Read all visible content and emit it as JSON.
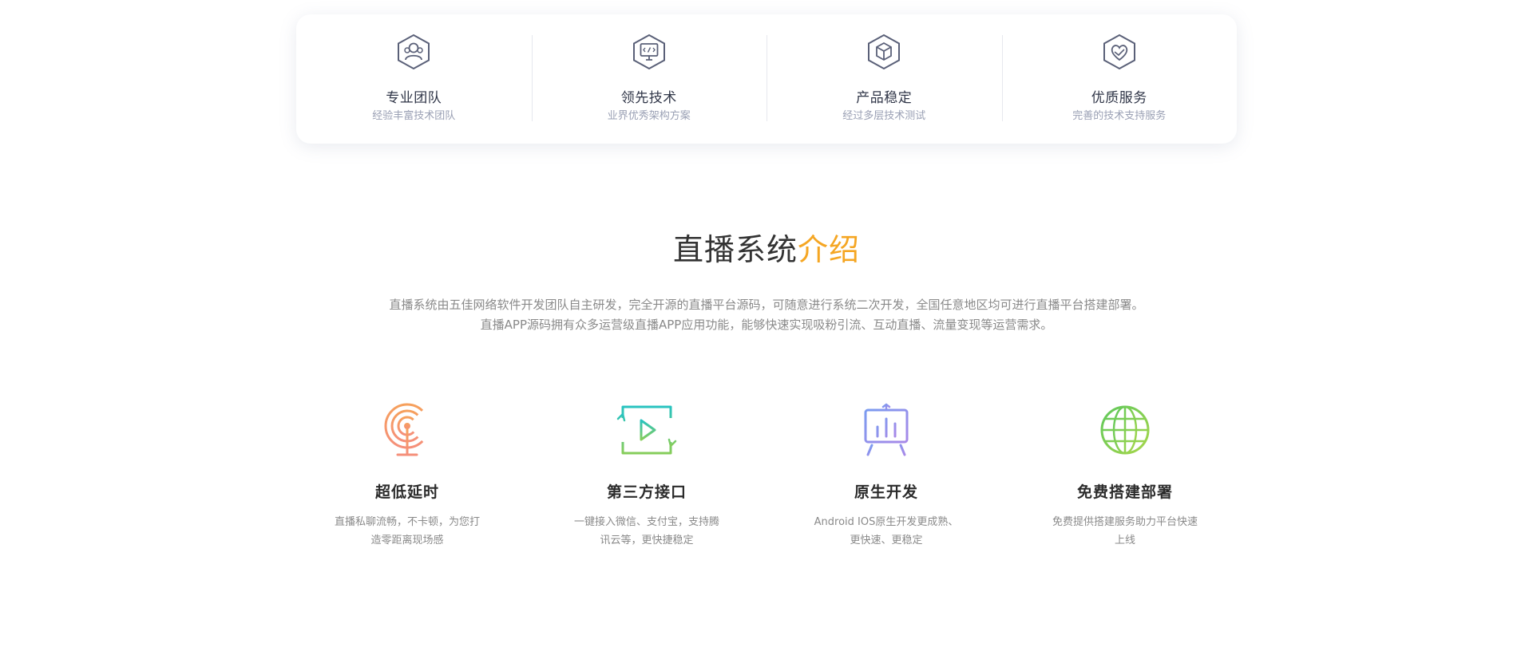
{
  "features": [
    {
      "icon": "team-icon",
      "title": "专业团队",
      "subtitle": "经验丰富技术团队"
    },
    {
      "icon": "code-monitor-icon",
      "title": "领先技术",
      "subtitle": "业界优秀架构方案"
    },
    {
      "icon": "cube-icon",
      "title": "产品稳定",
      "subtitle": "经过多层技术测试"
    },
    {
      "icon": "handshake-heart-icon",
      "title": "优质服务",
      "subtitle": "完善的技术支持服务"
    }
  ],
  "intro": {
    "title_main": "直播系统",
    "title_accent": "介绍",
    "accent_color": "#f5a623",
    "desc_line1": "直播系统由五佳网络软件开发团队自主研发，完全开源的直播平台源码，可随意进行系统二次开发，全国任意地区均可进行直播平台搭建部署。",
    "desc_line2": "直播APP源码拥有众多运营级直播APP应用功能，能够快速实现吸粉引流、互动直播、流量变现等运营需求。"
  },
  "advantages": [
    {
      "icon": "broadcast-tower-icon",
      "title": "超低延时",
      "desc": "直播私聊流畅，不卡顿，为您打造零距离现场感",
      "color": "#f7a05a"
    },
    {
      "icon": "play-sync-icon",
      "title": "第三方接口",
      "desc": "一键接入微信、支付宝，支持腾讯云等，更快捷稳定",
      "color": "#3cc9a8"
    },
    {
      "icon": "presentation-board-icon",
      "title": "原生开发",
      "desc": "Android IOS原生开发更成熟、更快速、更稳定",
      "color": "#8a8ef0"
    },
    {
      "icon": "globe-icon",
      "title": "免费搭建部署",
      "desc": "免费提供搭建服务助力平台快速上线",
      "color": "#7ccc4e"
    }
  ]
}
